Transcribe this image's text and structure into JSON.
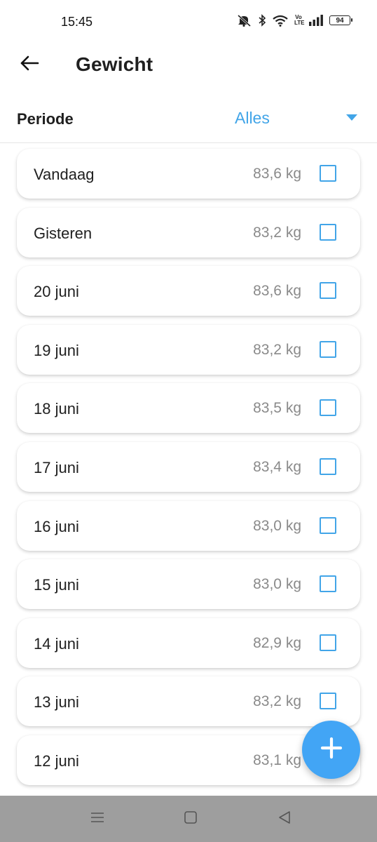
{
  "status_bar": {
    "time": "15:45",
    "battery": "94",
    "volte": [
      "Vo",
      "LTE"
    ],
    "icons": [
      "mute-icon",
      "bluetooth-icon",
      "wifi-icon",
      "volte-icon",
      "signal-icon",
      "battery-icon"
    ]
  },
  "app_bar": {
    "title": "Gewicht",
    "back_icon": "arrow-left-icon"
  },
  "period": {
    "label": "Periode",
    "value": "Alles"
  },
  "entries": [
    {
      "date": "Vandaag",
      "weight": "83,6 kg",
      "checked": false
    },
    {
      "date": "Gisteren",
      "weight": "83,2 kg",
      "checked": false
    },
    {
      "date": "20 juni",
      "weight": "83,6 kg",
      "checked": false
    },
    {
      "date": "19 juni",
      "weight": "83,2 kg",
      "checked": false
    },
    {
      "date": "18 juni",
      "weight": "83,5 kg",
      "checked": false
    },
    {
      "date": "17 juni",
      "weight": "83,4 kg",
      "checked": false
    },
    {
      "date": "16 juni",
      "weight": "83,0 kg",
      "checked": false
    },
    {
      "date": "15 juni",
      "weight": "83,0 kg",
      "checked": false
    },
    {
      "date": "14 juni",
      "weight": "82,9 kg",
      "checked": false
    },
    {
      "date": "13 juni",
      "weight": "83,2 kg",
      "checked": false
    },
    {
      "date": "12 juni",
      "weight": "83,1 kg",
      "checked": false
    }
  ],
  "fab": {
    "icon": "plus-icon"
  },
  "colors": {
    "accent": "#42a5e8",
    "fab": "#42a5f5",
    "nav_bar": "#9e9e9e"
  }
}
